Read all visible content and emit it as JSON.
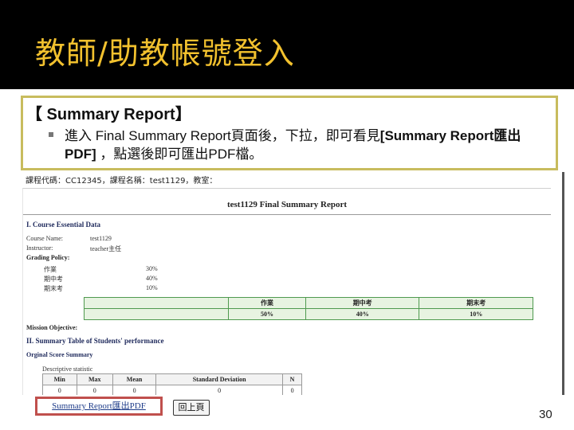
{
  "slide": {
    "title": "教師/助教帳號登入",
    "heading": "【 Summary Report】",
    "bullet_normal": "進入 Final Summary Report頁面後，下拉，即可看見",
    "bullet_bold_1": "[Summary Report匯出PDF]",
    "bullet_after": " ，點選後即可匯出PDF檔。",
    "page_number": "30",
    "accent_title_color": "#f2c12e",
    "callout_border_color": "#c8bc5e"
  },
  "screen": {
    "course_line": "課程代碼：CC12345，課程名稱：test1129，教室：",
    "report_title": "test1129 Final Summary Report",
    "section1_title": "I. Course Essential Data",
    "course_name_label": "Course Name:",
    "course_name_value": "test1129",
    "instructor_label": "Instructor:",
    "instructor_value": "teacher主任",
    "grading_policy_label": "Grading Policy:",
    "grading_items": [
      {
        "name": "作業",
        "pct": "30%"
      },
      {
        "name": "期中考",
        "pct": "40%"
      },
      {
        "name": "期末考",
        "pct": "10%"
      }
    ],
    "weights_table": {
      "headers": [
        "作業",
        "期中考",
        "期末考"
      ],
      "values": [
        "50%",
        "40%",
        "10%"
      ]
    },
    "mission_label": "Mission Objective:",
    "section2_title": "II. Summary Table of Students' performance",
    "sub_title": "Orginal Score Summary",
    "desc_title": "Descriptive statistic",
    "desc_table": {
      "headers": [
        "Min",
        "Max",
        "Mean",
        "Standard Deviation",
        "N"
      ],
      "row": [
        "0",
        "0",
        "0",
        "0",
        "0"
      ]
    },
    "export_link": "Summary Report匯出PDF",
    "back_button": "回上頁"
  }
}
